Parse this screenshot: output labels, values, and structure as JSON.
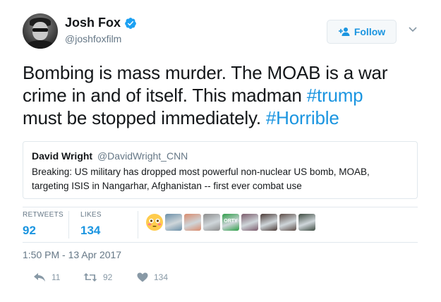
{
  "author": {
    "display_name": "Josh Fox",
    "handle": "@joshfoxfilm",
    "verified": true
  },
  "follow_button": {
    "label": "Follow"
  },
  "tweet": {
    "lines": [
      [
        "Bombing is mass murder.  The MOAB is a war",
        ""
      ],
      [
        "crime in and of itself.   This madman ",
        "#trump"
      ],
      [
        "must be stopped immediately.  ",
        "#Horrible"
      ]
    ]
  },
  "quoted_tweet": {
    "author_name": "David Wright",
    "author_handle": "@DavidWright_CNN",
    "text": "Breaking: US military has dropped most powerful non-nuclear US bomb, MOAB, targeting ISIS in Nangarhar, Afghanistan -- first ever combat use"
  },
  "stats": {
    "retweets_label": "RETWEETS",
    "retweets_count": "92",
    "likes_label": "LIKES",
    "likes_count": "134"
  },
  "likers": [
    {
      "name": "flushed-emoji-avatar",
      "color": "#ffcc4d"
    },
    {
      "name": "liker-avatar-2",
      "color": "#6b8fa8"
    },
    {
      "name": "liker-avatar-3",
      "color": "#d98a6c"
    },
    {
      "name": "liker-avatar-4",
      "color": "#8c8c8c"
    },
    {
      "name": "liker-avatar-5",
      "color": "#2e9e48"
    },
    {
      "name": "liker-avatar-6",
      "color": "#7a5a6a"
    },
    {
      "name": "liker-avatar-7",
      "color": "#4a3a36"
    },
    {
      "name": "liker-avatar-8",
      "color": "#5c4c46"
    },
    {
      "name": "liker-avatar-9",
      "color": "#3d4a40"
    }
  ],
  "liker_badge_text": "ORTY",
  "timestamp": "1:50 PM - 13 Apr 2017",
  "actions": {
    "reply_count": "11",
    "retweet_count": "92",
    "like_count": "134"
  },
  "colors": {
    "accent": "#1b95e0",
    "muted": "#657786",
    "border": "#e1e8ed"
  }
}
